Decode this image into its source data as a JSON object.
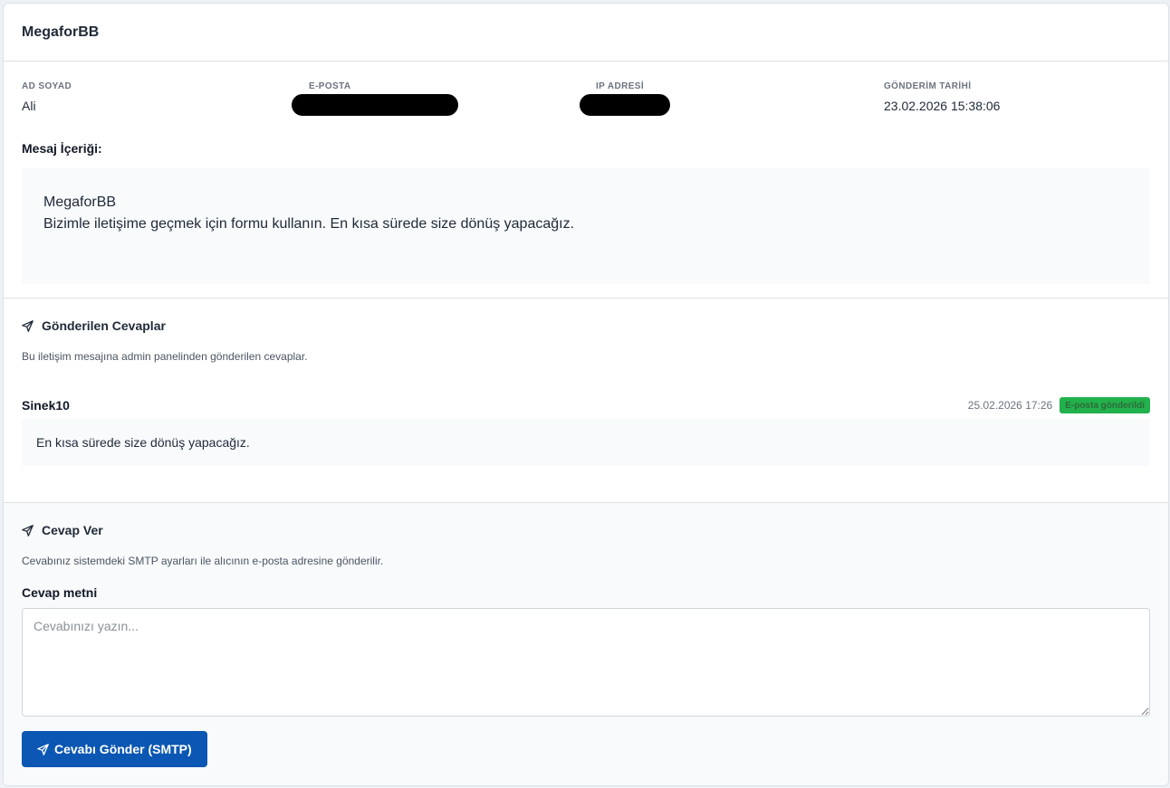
{
  "header": {
    "title": "MegaforBB"
  },
  "info": {
    "name_label": "AD SOYAD",
    "name_value": "Ali",
    "email_label": "E-POSTA",
    "ip_label": "IP ADRESİ",
    "date_label": "GÖNDERİM TARİHİ",
    "date_value": "23.02.2026 15:38:06"
  },
  "message": {
    "label": "Mesaj İçeriği:",
    "line1": "MegaforBB",
    "line2": "Bizimle iletişime geçmek için formu kullanın. En kısa sürede size dönüş yapacağız."
  },
  "replies": {
    "title": "Gönderilen Cevaplar",
    "description": "Bu iletişim mesajına admin panelinden gönderilen cevaplar.",
    "items": [
      {
        "author": "Sinek10",
        "date": "25.02.2026 17:26",
        "badge": "E-posta gönderildi",
        "body": "En kısa sürede size dönüş yapacağız."
      }
    ]
  },
  "compose": {
    "title": "Cevap Ver",
    "description": "Cevabınız sistemdeki SMTP ayarları ile alıcının e-posta adresine gönderilir.",
    "field_label": "Cevap metni",
    "placeholder": "Cevabınızı yazın...",
    "submit_label": "Cevabı Gönder (SMTP)"
  },
  "colors": {
    "primary": "#0b57b3",
    "badge_green": "#22b14c"
  }
}
